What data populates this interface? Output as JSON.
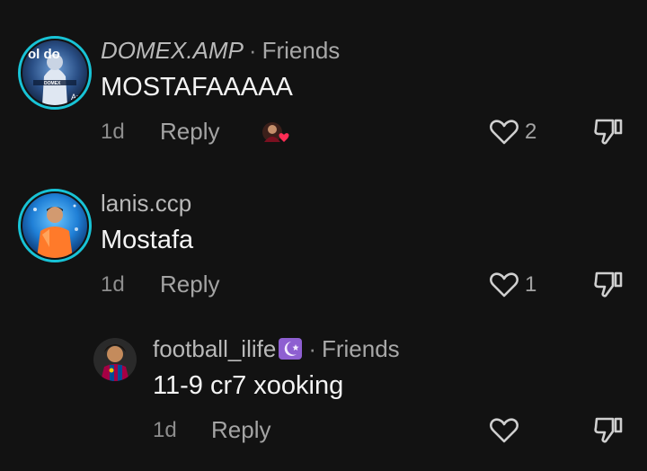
{
  "comments": [
    {
      "username": "DOMEX.AMP",
      "separator": "·",
      "tag": "Friends",
      "text": "MOSTAFAAAAA",
      "time": "1d",
      "reply_label": "Reply",
      "like_count": "2",
      "avatar_text": "ol do",
      "avatar_sub": "DOMEX",
      "avatar_mark": "Ar"
    },
    {
      "username": "lanis.ccp",
      "text": "Mostafa",
      "time": "1d",
      "reply_label": "Reply",
      "like_count": "1"
    },
    {
      "username": "football_ilife",
      "separator": "·",
      "tag": "Friends",
      "text": "11-9 cr7 xooking",
      "time": "1d",
      "reply_label": "Reply",
      "like_count": ""
    }
  ],
  "colors": {
    "background": "#121212",
    "avatar_ring": "#18c3d6",
    "heart_reaction": "#ff2d55",
    "moon_emoji": "#8e5fd1"
  },
  "icons": [
    "heart-outline-icon",
    "thumbs-down-icon",
    "crescent-moon-icon",
    "red-heart-icon"
  ]
}
